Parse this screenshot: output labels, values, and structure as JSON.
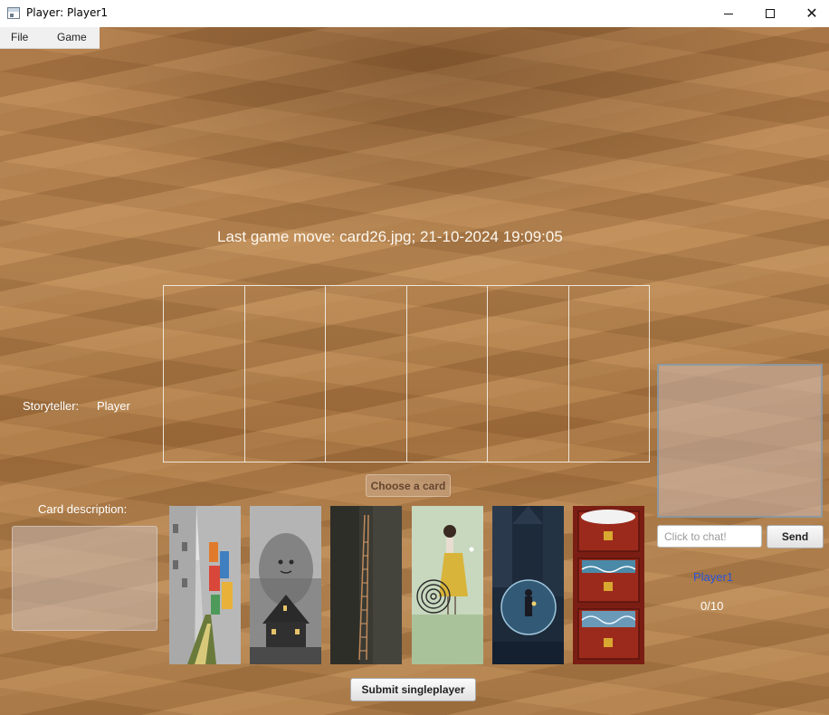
{
  "window": {
    "title": "Player: Player1",
    "app_icon": "window-app-icon",
    "controls": [
      "minimize-icon",
      "maximize-icon",
      "close-icon"
    ]
  },
  "menu": {
    "items": [
      {
        "label": "File"
      },
      {
        "label": "Game"
      }
    ]
  },
  "game": {
    "last_move": "Last game move: card26.jpg; 21-10-2024 19:09:05",
    "table_slot_count": 6,
    "storyteller_label": "Storyteller:",
    "storyteller_value": "Player",
    "choose_button": "Choose a card",
    "card_description_label": "Card description:",
    "submit_button": "Submit singleplayer"
  },
  "hand": {
    "cards": [
      {
        "image": "narrow-street-colorful-houses"
      },
      {
        "image": "dark-haunted-house-ghost"
      },
      {
        "image": "ladder-in-dark-crevice"
      },
      {
        "image": "girl-in-yellow-dress-spiral"
      },
      {
        "image": "snow-globe-night-figure"
      },
      {
        "image": "red-drawers-with-snow-and-sea"
      }
    ]
  },
  "chat": {
    "placeholder": "Click to chat!",
    "send_button": "Send"
  },
  "player": {
    "name": "Player1",
    "score": "0/10"
  },
  "colors": {
    "desert": "#b07a47",
    "player_name": "#2b55d8",
    "slot_border": "#efe6da"
  }
}
